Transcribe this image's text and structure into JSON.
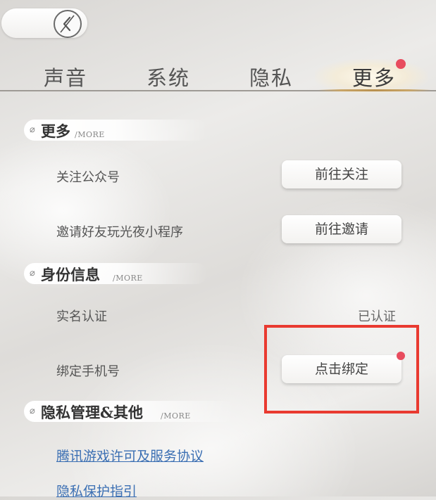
{
  "tabs": [
    {
      "label": "声音",
      "active": false
    },
    {
      "label": "系统",
      "active": false
    },
    {
      "label": "隐私",
      "active": false
    },
    {
      "label": "更多",
      "active": true
    }
  ],
  "sections": {
    "more": {
      "title": "更多",
      "subtitle": "/MORE",
      "rows": [
        {
          "label": "关注公众号",
          "button": "前往关注"
        },
        {
          "label": "邀请好友玩光夜小程序",
          "button": "前往邀请"
        }
      ]
    },
    "identity": {
      "title": "身份信息",
      "subtitle": "/MORE",
      "rows": [
        {
          "label": "实名认证",
          "status": "已认证"
        },
        {
          "label": "绑定手机号",
          "button": "点击绑定"
        }
      ]
    },
    "privacy": {
      "title": "隐私管理&其他",
      "subtitle": "/MORE",
      "links": [
        "腾讯游戏许可及服务协议",
        "隐私保护指引"
      ]
    }
  },
  "colors": {
    "accent_dot": "#e84c5e",
    "link": "#3b6fb3",
    "highlight_box": "#e93a30"
  },
  "icons": {
    "back": "back-arrow-icon",
    "section": "feather-icon"
  }
}
